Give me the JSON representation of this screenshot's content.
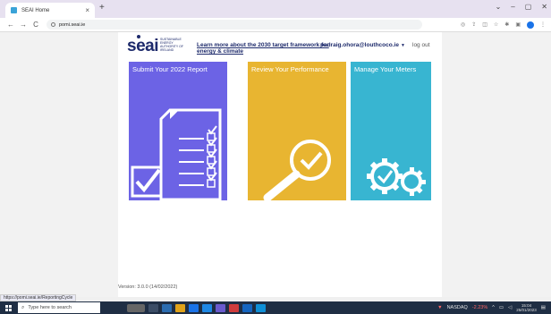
{
  "browser": {
    "tab_title": "SEAI Home",
    "tab_close": "×",
    "new_tab": "+",
    "window_controls": [
      "⌄",
      "–",
      "▢",
      "✕"
    ],
    "nav": {
      "back": "←",
      "forward": "→",
      "reload": "C"
    },
    "address": "pomi.seai.ie"
  },
  "page": {
    "logo": {
      "word": "seai",
      "tagline": "SUSTAINABLE ENERGY AUTHORITY OF IRELAND"
    },
    "learn_more": "Learn more about the 2030 target framework for energy & climate",
    "user_email": "padraig.ohora@louthcoco.ie",
    "user_caret": "▼",
    "logout": "log out",
    "tiles": {
      "submit": "Submit Your 2022 Report",
      "review": "Review Your Performance",
      "meters": "Manage Your Meters"
    },
    "version": "Version: 3.0.0 (14/02/2022)"
  },
  "status_url": "https://pomi.seai.ie/ReportingCycle",
  "taskbar": {
    "search_placeholder": "Type here to search",
    "nasdaq_label": "NASDAQ",
    "nasdaq_change": "-2.23%",
    "clock_time": "15:04",
    "clock_date": "25/01/2023"
  },
  "colors": {
    "submit_tile": "#6c63e5",
    "review_tile": "#e8b531",
    "meters_tile": "#38b5d1",
    "brand_navy": "#1d2a6b"
  }
}
